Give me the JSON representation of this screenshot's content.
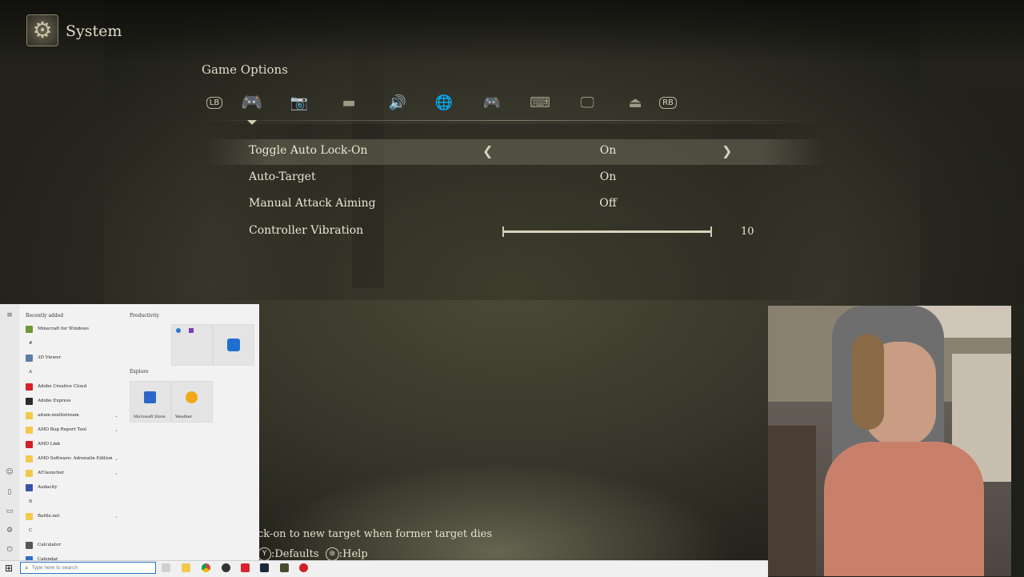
{
  "game": {
    "system_title": "System",
    "section_title": "Game Options",
    "tabs": [
      {
        "name": "lb",
        "label": "LB"
      },
      {
        "name": "controller",
        "glyph": "🎮"
      },
      {
        "name": "camera",
        "glyph": "📷"
      },
      {
        "name": "display-bars",
        "glyph": "▬"
      },
      {
        "name": "sound",
        "glyph": "🔊"
      },
      {
        "name": "network",
        "glyph": "🌐"
      },
      {
        "name": "controls",
        "glyph": "🎮"
      },
      {
        "name": "keyboard",
        "glyph": "⌨"
      },
      {
        "name": "monitor",
        "glyph": "🖵"
      },
      {
        "name": "quit",
        "glyph": "⏏"
      },
      {
        "name": "rb",
        "label": "RB"
      }
    ],
    "options": [
      {
        "label": "Toggle Auto Lock-On",
        "value": "On"
      },
      {
        "label": "Auto-Target",
        "value": "On"
      },
      {
        "label": "Manual Attack Aiming",
        "value": "Off"
      },
      {
        "label": "Controller Vibration",
        "value": "10"
      }
    ],
    "vibration_level": 10,
    "vibration_max": 10,
    "help_text": "ck-on to new target when former target dies",
    "key_defaults_glyph": "Y",
    "key_defaults_label": ":Defaults",
    "key_help_glyph": "⊜",
    "key_help_label": ":Help"
  },
  "start_menu": {
    "recently_added_header": "Recently added",
    "productivity_header": "Productivity",
    "explore_header": "Explore",
    "apps": [
      {
        "label": "Minecraft for Windows",
        "color": "#6a9a3a"
      },
      {
        "letter": "#"
      },
      {
        "label": "3D Viewer",
        "color": "#5a7fa8"
      },
      {
        "letter": "A"
      },
      {
        "label": "Adobe Creative Cloud",
        "color": "#da1f26"
      },
      {
        "label": "Adobe Express",
        "color": "#2b2b2b"
      },
      {
        "label": "aitum-multistream",
        "color": "#f2c94c",
        "chev": true
      },
      {
        "label": "AMD Bug Report Tool",
        "color": "#f2c94c",
        "chev": true
      },
      {
        "label": "AMD Link",
        "color": "#d0202a"
      },
      {
        "label": "AMD Software: Adrenalin Edition",
        "color": "#f2c94c",
        "chev": true
      },
      {
        "label": "AF.launcher",
        "color": "#f2c94c",
        "chev": true
      },
      {
        "label": "Audacity",
        "color": "#3553a8"
      },
      {
        "letter": "B"
      },
      {
        "label": "Battle.net",
        "color": "#f2c94c",
        "chev": true
      },
      {
        "letter": "C"
      },
      {
        "label": "Calculator",
        "color": "#555555"
      },
      {
        "label": "Calendar",
        "color": "#2e6fc4"
      }
    ],
    "tiles": {
      "store_label": "Microsoft Store",
      "weather_label": "Weather"
    }
  },
  "taskbar": {
    "search_placeholder": "Type here to search"
  }
}
